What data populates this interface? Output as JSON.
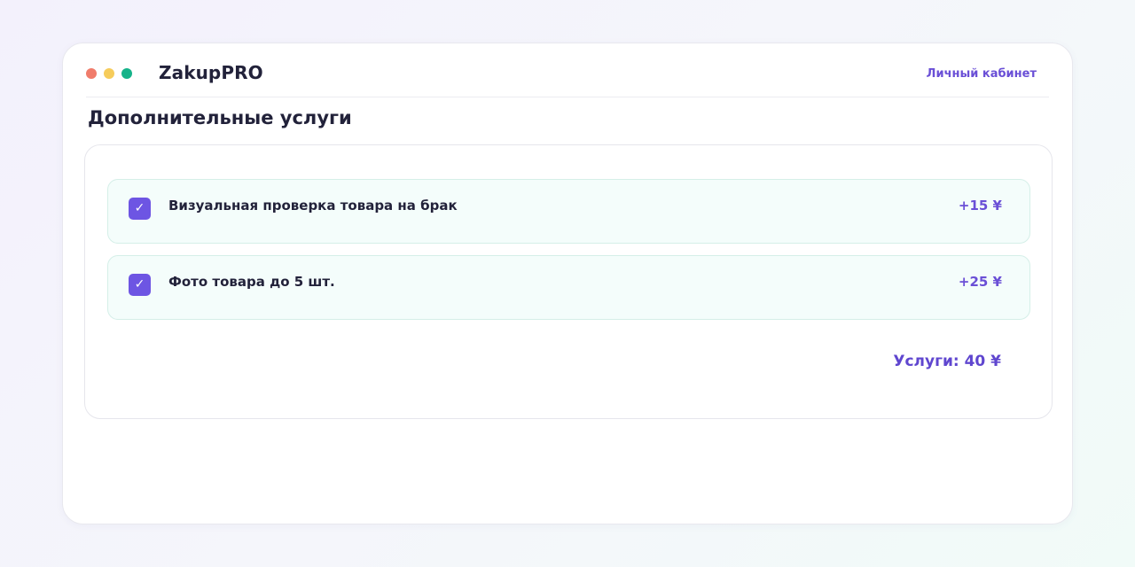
{
  "window": {
    "controls": [
      "close-dot",
      "minimize-dot",
      "maximize-dot"
    ]
  },
  "header": {
    "brand": "ZakupPRO",
    "account_link": "Личный кабинет"
  },
  "page": {
    "title": "Дополнительные услуги"
  },
  "services": [
    {
      "label": "Визуальная проверка товара на брак",
      "price": "+15 ¥",
      "checked": true,
      "check_glyph": "✓"
    },
    {
      "label": "Фото товара до 5 шт.",
      "price": "+25 ¥",
      "checked": true,
      "check_glyph": "✓"
    }
  ],
  "summary": {
    "total_label": "Услуги: 40 ¥"
  },
  "colors": {
    "accent": "#6a4fd6",
    "checkbox": "#6d55e3",
    "row_background": "#f4fdfb",
    "dot_red": "#f07c6b",
    "dot_yellow": "#f6cc5b",
    "dot_green": "#16b38a"
  }
}
